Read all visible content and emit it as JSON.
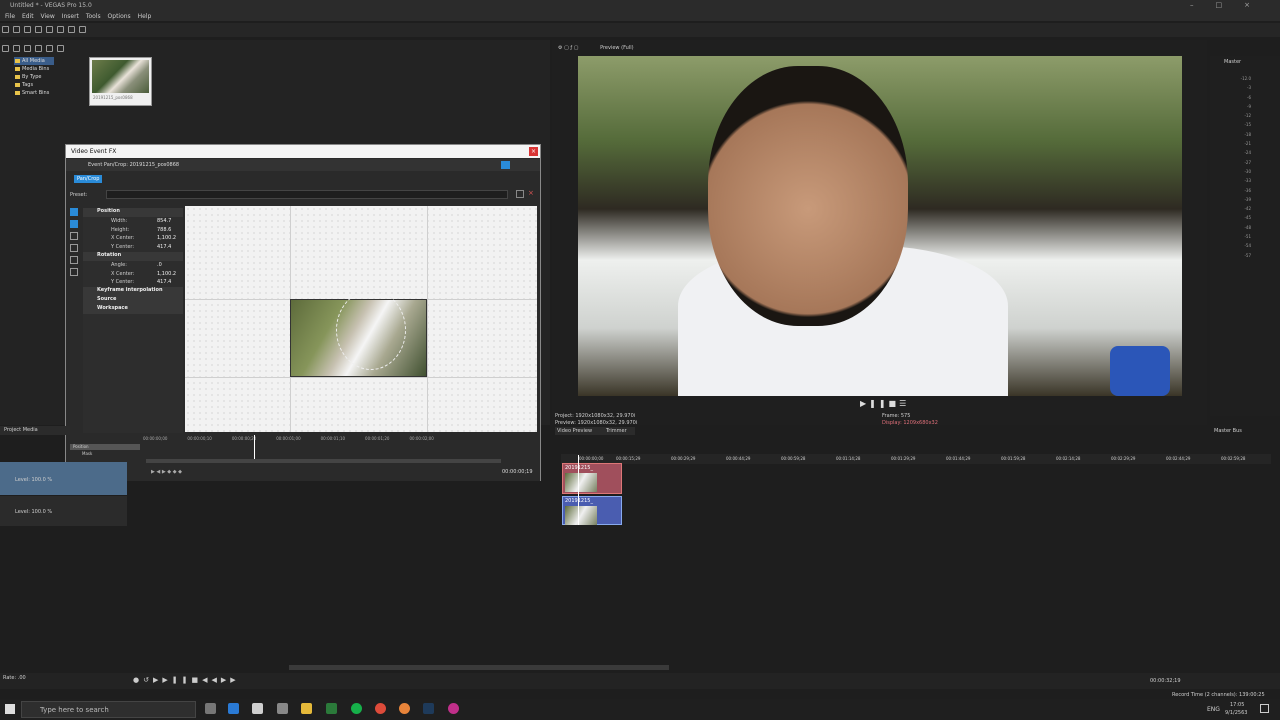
{
  "window": {
    "title": "Untitled * - VEGAS Pro 15.0"
  },
  "menu": [
    "File",
    "Edit",
    "View",
    "Insert",
    "Tools",
    "Options",
    "Help"
  ],
  "explorer": {
    "tree": [
      "All Media",
      "Media Bins",
      "By Type",
      "Tags",
      "Smart Bins"
    ],
    "selected": "All Media",
    "thumb_label": "20191215_pos0868"
  },
  "fx": {
    "title": "Video Event FX",
    "header": "Event Pan/Crop:  20191215_pos0868",
    "chip": "Pan/Crop",
    "preset_label": "Preset:",
    "sections": [
      {
        "name": "Position",
        "rows": [
          [
            "Width:",
            "854.7"
          ],
          [
            "Height:",
            "788.6"
          ],
          [
            "X Center:",
            "1,100.2"
          ],
          [
            "Y Center:",
            "417.4"
          ]
        ]
      },
      {
        "name": "Rotation",
        "rows": [
          [
            "Angle:",
            ".0"
          ],
          [
            "X Center:",
            "1,100.2"
          ],
          [
            "Y Center:",
            "417.4"
          ]
        ]
      },
      {
        "name": "Keyframe interpolation",
        "rows": []
      },
      {
        "name": "Source",
        "rows": []
      },
      {
        "name": "Workspace",
        "rows": []
      }
    ],
    "timeline_ticks": [
      "00:00:00;00",
      "00:00:00;10",
      "00:00:00;20",
      "00:00:01;00",
      "00:00:01;10",
      "00:00:01;20",
      "00:00:02;00"
    ],
    "tracks": [
      "Position",
      "Mask"
    ],
    "end_time": "00:00:00;19"
  },
  "preview": {
    "toolbar_label": "Preview (Full)",
    "project": "Project: 1920x1080x32, 29.970i",
    "preview_res": "Preview: 1920x1080x32, 29.970i",
    "frame": "Frame: 575",
    "display": "Display: 1209x680x32",
    "tab1": "Video Preview",
    "tab2": "Trimmer",
    "master": "Master",
    "master_bus": "Master Bus",
    "meter_ticks": [
      "-12.0",
      "-12.0",
      "-3",
      "-6",
      "-9",
      "-12",
      "-15",
      "-18",
      "-21",
      "-24",
      "-27",
      "-30",
      "-33",
      "-36",
      "-39",
      "-42",
      "-45",
      "-48",
      "-51",
      "-54",
      "-57"
    ]
  },
  "project_media": {
    "tab": "Project Media"
  },
  "tracks": {
    "a_level": "Level: 100.0 %",
    "b_level": "Level: 100.0 %"
  },
  "timeline": {
    "ruler": [
      "00:00:00;00",
      "00:00:15;29",
      "00:00:29;29",
      "00:00:44;29",
      "00:00:59;28",
      "00:01:14;28",
      "00:01:29;29",
      "00:01:44;29",
      "00:01:59;28",
      "00:02:14;28",
      "00:02:29;29",
      "00:02:44;29",
      "00:02:59;28",
      "00:03:14;28"
    ],
    "clip1": "20191215_",
    "clip2": "20191215_"
  },
  "transport": {
    "rate": "Rate: .00",
    "time": "00:00:32;19",
    "record_time": "Record Time (2 channels): 139:00:25"
  },
  "taskbar": {
    "search": "Type here to search",
    "lang": "ENG",
    "time": "17:05",
    "date": "9/1/2563"
  }
}
